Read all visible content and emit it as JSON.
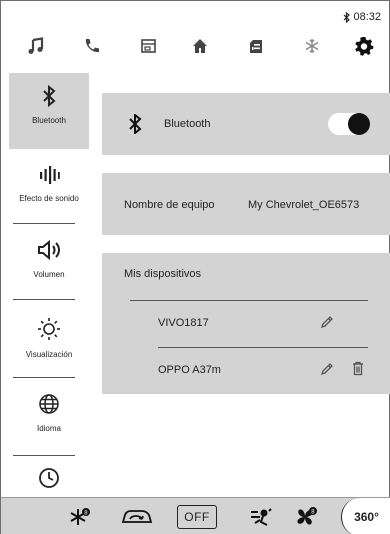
{
  "status": {
    "time": "08:32",
    "bt_icon": "bluetooth-icon"
  },
  "topnav": {
    "icons": [
      "music-note-icon",
      "phone-icon",
      "projection-icon",
      "home-icon",
      "vehicle-info-icon",
      "climate-snowflake-icon",
      "settings-gear-icon"
    ],
    "active": "settings-gear-icon"
  },
  "sidebar": {
    "items": [
      {
        "label": "Bluetooth",
        "icon": "bluetooth-icon",
        "active": true
      },
      {
        "label": "Efecto de sonido",
        "icon": "equalizer-icon",
        "active": false
      },
      {
        "label": "Volumen",
        "icon": "speaker-icon",
        "active": false
      },
      {
        "label": "Visualización",
        "icon": "brightness-icon",
        "active": false
      },
      {
        "label": "Idioma",
        "icon": "globe-icon",
        "active": false
      },
      {
        "label": "",
        "icon": "clock-icon",
        "active": false
      }
    ]
  },
  "bluetooth": {
    "label": "Bluetooth",
    "enabled": true
  },
  "device_name": {
    "label": "Nombre de equipo",
    "value": "My Chevrolet_OE6573"
  },
  "devices": {
    "title": "Mis dispositivos",
    "list": [
      {
        "name": "VIVO1817",
        "editable": true,
        "deletable": false
      },
      {
        "name": "OPPO A37m",
        "editable": true,
        "deletable": true
      }
    ]
  },
  "climate": {
    "off_label": "OFF",
    "view_label": "360°",
    "icons": [
      "rear-defrost-icon",
      "recirculation-icon",
      "ac-off-button",
      "airflow-icon",
      "fan-icon",
      "camera-360-icon"
    ]
  },
  "colors": {
    "panel_bg": "#d3d3d3",
    "toggle_knob": "#111111",
    "background": "#ffffff"
  }
}
